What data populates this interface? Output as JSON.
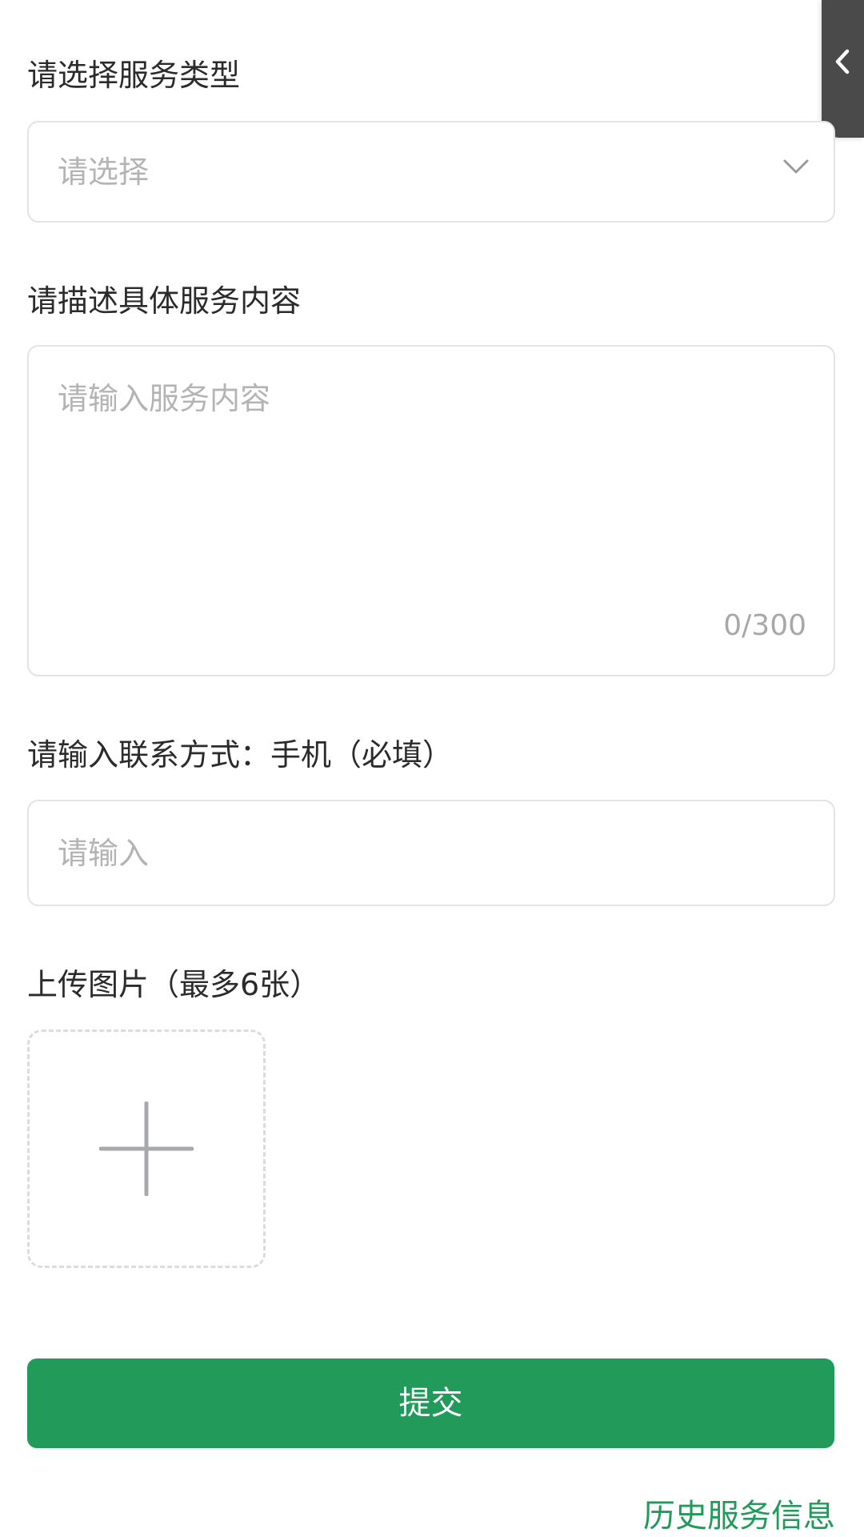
{
  "service_type": {
    "label": "请选择服务类型",
    "placeholder": "请选择"
  },
  "service_content": {
    "label": "请描述具体服务内容",
    "placeholder": "请输入服务内容",
    "counter": "0/300"
  },
  "contact": {
    "label": "请输入联系方式：手机（必填）",
    "placeholder": "请输入"
  },
  "upload": {
    "label": "上传图片（最多6张）"
  },
  "actions": {
    "submit_label": "提交",
    "history_link": "历史服务信息"
  },
  "icons": {
    "side_tab": "chevron-left-icon",
    "select": "chevron-down-icon",
    "upload": "plus-icon"
  },
  "colors": {
    "primary": "#219a5a",
    "side_tab": "#4a4a4a",
    "placeholder": "#b4b4b4",
    "border": "#e3e3e3"
  }
}
